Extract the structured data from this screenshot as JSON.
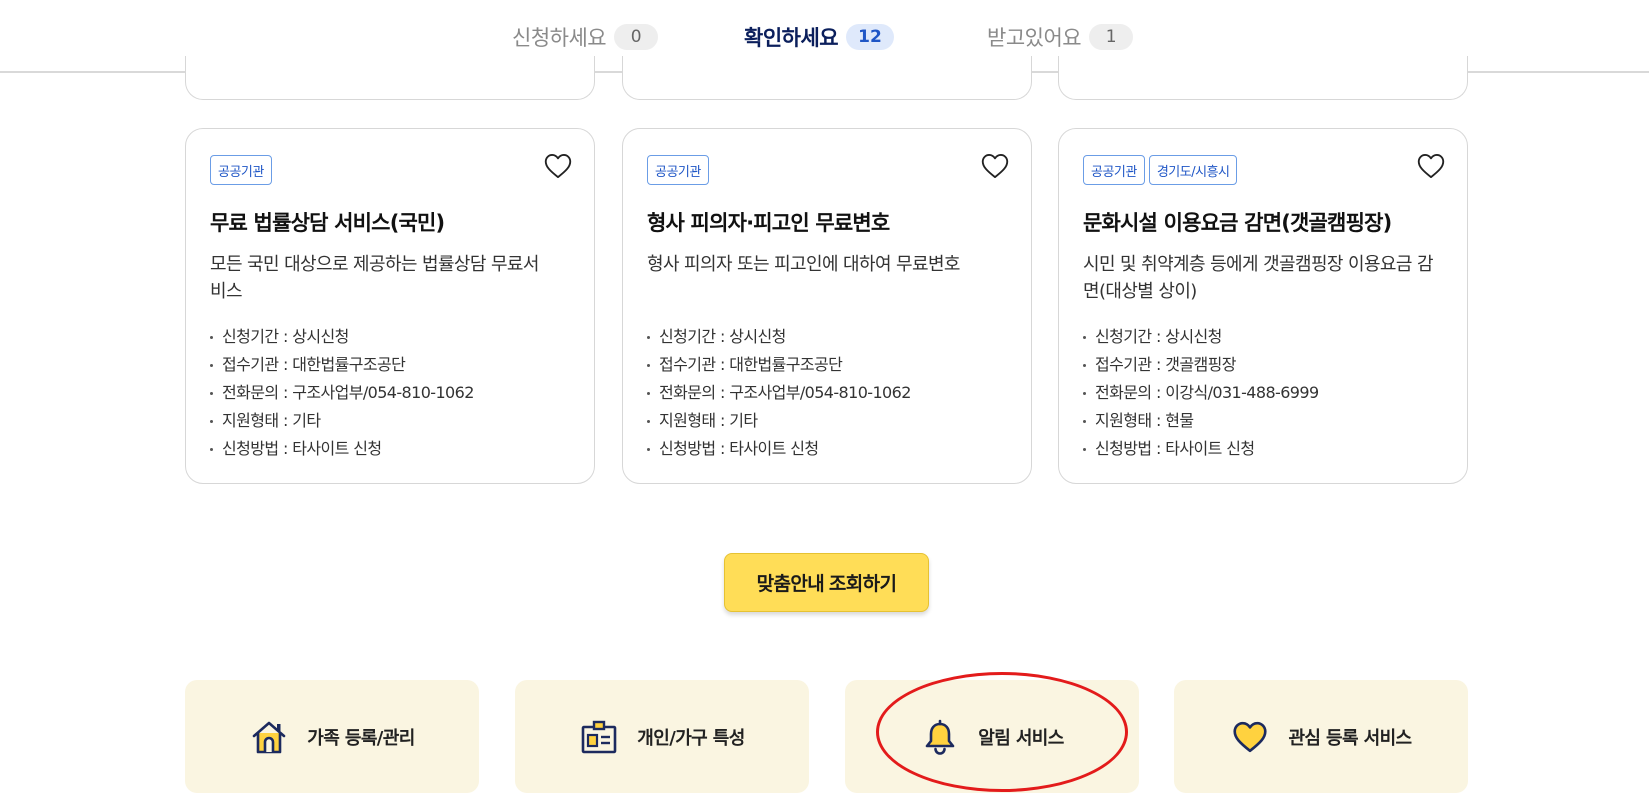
{
  "tabs": [
    {
      "label": "신청하세요",
      "count": "0"
    },
    {
      "label": "확인하세요",
      "count": "12"
    },
    {
      "label": "받고있어요",
      "count": "1"
    }
  ],
  "cards": [
    {
      "tags": [
        "공공기관"
      ],
      "title": "무료 법률상담 서비스(국민)",
      "desc": "모든 국민 대상으로 제공하는 법률상담 무료서비스",
      "info": [
        "신청기간 : 상시신청",
        "접수기관 : 대한법률구조공단",
        "전화문의 : 구조사업부/054-810-1062",
        "지원형태 : 기타",
        "신청방법 : 타사이트 신청"
      ]
    },
    {
      "tags": [
        "공공기관"
      ],
      "title": "형사 피의자·피고인 무료변호",
      "desc": "형사 피의자 또는 피고인에 대하여 무료변호",
      "info": [
        "신청기간 : 상시신청",
        "접수기관 : 대한법률구조공단",
        "전화문의 : 구조사업부/054-810-1062",
        "지원형태 : 기타",
        "신청방법 : 타사이트 신청"
      ]
    },
    {
      "tags": [
        "공공기관",
        "경기도/시흥시"
      ],
      "title": "문화시설 이용요금 감면(갯골캠핑장)",
      "desc": "시민 및 취약계층 등에게 갯골캠핑장 이용요금 감면(대상별 상이)",
      "info": [
        "신청기간 : 상시신청",
        "접수기관 : 갯골캠핑장",
        "전화문의 : 이강식/031-488-6999",
        "지원형태 : 현물",
        "신청방법 : 타사이트 신청"
      ]
    }
  ],
  "cta": {
    "label": "맞춤안내 조회하기"
  },
  "menu": [
    {
      "label": "가족 등록/관리",
      "icon": "house-icon"
    },
    {
      "label": "개인/가구 특성",
      "icon": "id-card-icon"
    },
    {
      "label": "알림 서비스",
      "icon": "bell-icon"
    },
    {
      "label": "관심 등록 서비스",
      "icon": "heart-filled-icon"
    }
  ],
  "colors": {
    "navy": "#0b1f5c",
    "accent_blue": "#1f56c6",
    "cta_yellow": "#ffdd57",
    "menu_bg": "#faf5e1",
    "icon_yellow": "#ffd23f",
    "annotation_red": "#e31b1b"
  }
}
